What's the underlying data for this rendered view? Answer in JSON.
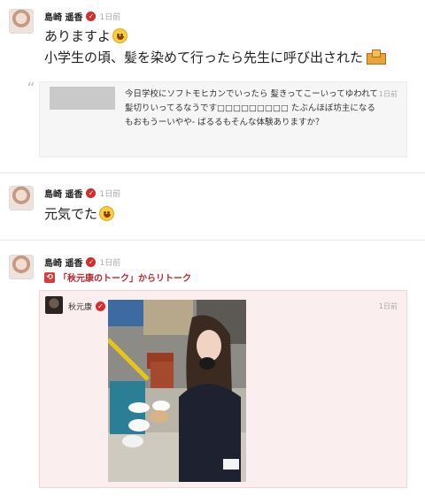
{
  "posts": [
    {
      "author": "島崎 遥香",
      "time": "1日前",
      "lines": [
        "ありますよ",
        "小学生の頃、髪を染めて行ったら先生に呼び出された"
      ],
      "emojis": [
        "smile-face-emoji",
        "school-building-emoji"
      ],
      "quote": {
        "text": "今日学校にソフトモヒカンでいったら 髪きってこーいってゆわれて髪切りいってるなうです□□□□□□□□□ たぶんほぼ坊主になるもおもうーいやや- ばるるもそんな体験ありますか？",
        "time": "1日前"
      }
    },
    {
      "author": "島崎 遥香",
      "time": "1日前",
      "text": "元気でた",
      "emojis": [
        "laughing-face-emoji"
      ]
    },
    {
      "author": "島崎 遥香",
      "time": "1日前",
      "retalk_label": "「秋元康のトーク」からリトーク",
      "retalk": {
        "author": "秋元康",
        "time": "1日前"
      }
    }
  ],
  "colors": {
    "accent": "#c0262d",
    "verified": "#d62c2c",
    "retalk_bg": "#fbeeee"
  },
  "icons": [
    "verified-badge-icon",
    "retalk-icon",
    "quote-mark-icon"
  ]
}
